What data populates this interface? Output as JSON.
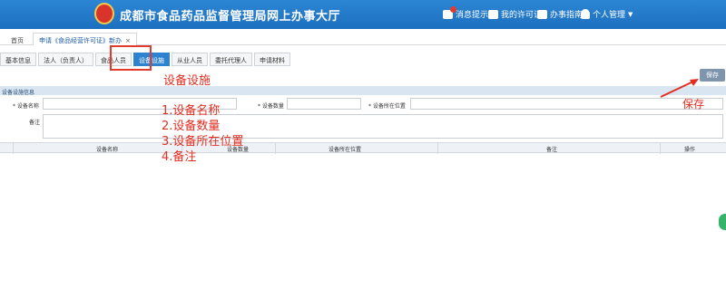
{
  "header": {
    "site_title": "成都市食品药品监督管理局网上办事大厅",
    "items": [
      {
        "label": "消息提示",
        "icon": "message-icon"
      },
      {
        "label": "我的许可证",
        "icon": "license-icon"
      },
      {
        "label": "办事指南",
        "icon": "guide-icon"
      },
      {
        "label": "个人管理",
        "icon": "user-icon"
      }
    ]
  },
  "tabstrip": {
    "home": "首页",
    "open_tab": "申请《食品经营许可证》新办",
    "close": "×"
  },
  "subtabs": [
    {
      "label": "基本信息",
      "active": false
    },
    {
      "label": "法人（负责人）",
      "active": false
    },
    {
      "label": "食品人员",
      "active": false
    },
    {
      "label": "设备设施",
      "active": true
    },
    {
      "label": "从业人员",
      "active": false
    },
    {
      "label": "委托代理人",
      "active": false
    },
    {
      "label": "申请材料",
      "active": false
    }
  ],
  "save_button": "保存",
  "section_title": "设备设施信息",
  "form": {
    "name_label": "* 设备名称",
    "count_label": "* 设备数量",
    "location_label": "* 设备所在位置",
    "remark_label": "备注"
  },
  "table": {
    "headers": [
      "设备名称",
      "设备数量",
      "设备所在位置",
      "备注",
      "操作"
    ]
  },
  "annotations": {
    "title": "设备设施",
    "items": [
      "1.设备名称",
      "2.设备数量",
      "3.设备所在位置",
      "4.备注"
    ],
    "save": "保存"
  },
  "colors": {
    "header_blue": "#1c6fbf",
    "active_tab": "#2d83cf",
    "annotation_red": "#e22d20"
  }
}
